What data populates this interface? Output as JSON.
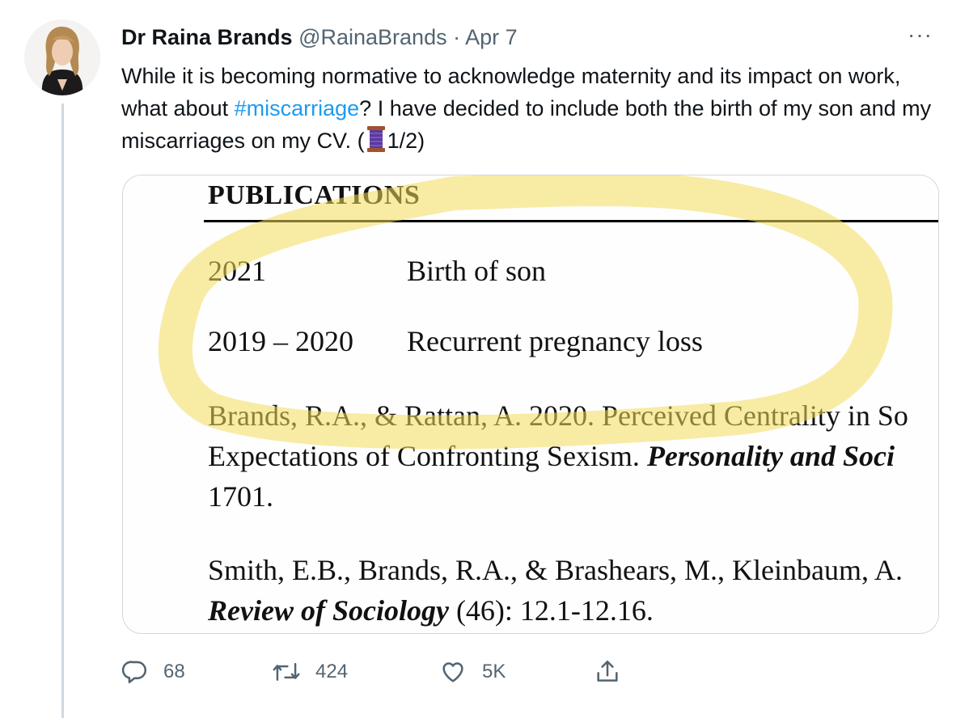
{
  "tweet": {
    "author_name": "Dr Raina Brands",
    "handle": "@RainaBrands",
    "separator": "·",
    "date": "Apr 7",
    "text_part1": "While it is becoming normative to acknowledge maternity and its impact on work, what about ",
    "hashtag": "#miscarriage",
    "text_part2": "?  I have decided to include both the birth of my son and my miscarriages on my CV. (",
    "text_emoji": "thread-spool-emoji",
    "text_part3": "1/2)",
    "more_label": "···"
  },
  "media": {
    "heading": "PUBLICATIONS",
    "entries": [
      {
        "year": "2021",
        "event": "Birth of son"
      },
      {
        "year": "2019 – 2020",
        "event": "Recurrent pregnancy loss"
      }
    ],
    "citation1_line1": "Brands, R.A., & Rattan, A. 2020. Perceived Centrality in So",
    "citation1_line2_plain": "Expectations of Confronting Sexism.  ",
    "citation1_line2_italic": "Personality and Soci",
    "citation1_line3": "1701.",
    "citation2_line1": "Smith, E.B., Brands, R.A., & Brashears, M., Kleinbaum, A.",
    "citation2_line2_italic": "Review of Sociology",
    "citation2_line2_plain": " (46): 12.1-12.16.",
    "highlight_color": "#f2da5a"
  },
  "actions": {
    "reply_count": "68",
    "retweet_count": "424",
    "like_count": "5K",
    "icons": [
      "reply-icon",
      "retweet-icon",
      "like-icon",
      "share-icon"
    ]
  },
  "colors": {
    "text": "#0f1419",
    "secondary": "#536471",
    "link": "#1d9bf0",
    "border": "#cfd9de"
  }
}
